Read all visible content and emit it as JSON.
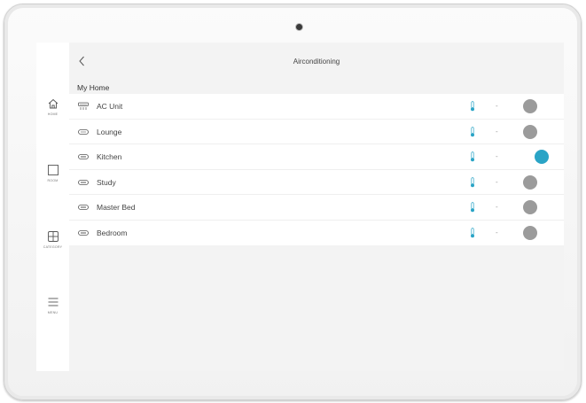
{
  "sidebar": {
    "items": [
      {
        "label": "HOME",
        "icon": "home-icon"
      },
      {
        "label": "ROOM",
        "icon": "room-icon"
      },
      {
        "label": "CATEGORY",
        "icon": "category-icon"
      },
      {
        "label": "MENU",
        "icon": "menu-icon"
      }
    ]
  },
  "header": {
    "title": "Airconditioning",
    "back_icon": "chevron-left-icon"
  },
  "section": {
    "title": "My Home"
  },
  "rows": [
    {
      "label": "AC Unit",
      "icon": "ac-unit-icon",
      "value": "-",
      "power": "off"
    },
    {
      "label": "Lounge",
      "icon": "ac-unit-icon",
      "value": "-",
      "power": "off"
    },
    {
      "label": "Kitchen",
      "icon": "ac-unit-icon",
      "value": "-",
      "power": "on"
    },
    {
      "label": "Study",
      "icon": "ac-unit-icon",
      "value": "-",
      "power": "off"
    },
    {
      "label": "Master Bed",
      "icon": "ac-unit-icon",
      "value": "-",
      "power": "off"
    },
    {
      "label": "Bedroom",
      "icon": "ac-unit-icon",
      "value": "-",
      "power": "off"
    }
  ],
  "colors": {
    "accent": "#2aa4c6",
    "toggle_off": "#9b9b9b",
    "thermometer": "#2aa4c6"
  }
}
